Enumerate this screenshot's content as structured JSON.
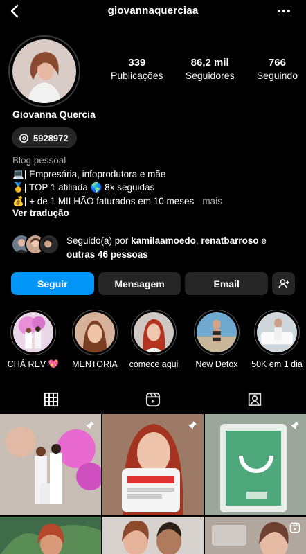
{
  "header": {
    "username": "giovannaquerciaa"
  },
  "profile": {
    "name": "Giovanna Quercia",
    "threads_count": "5928972",
    "stats": [
      {
        "num": "339",
        "label": "Publicações"
      },
      {
        "num": "86,2 mil",
        "label": "Seguidores"
      },
      {
        "num": "766",
        "label": "Seguindo"
      }
    ],
    "bio": {
      "category": "Blog pessoal",
      "line1": "💻| Empresária, infoprodutora e mãe",
      "line2": "🥇| TOP 1 afiliada 🌎 8x seguidas",
      "line3": "💰| + de 1 MILHÃO faturados em 10 meses",
      "more": "mais"
    },
    "translate": "Ver tradução",
    "followed_by": {
      "prefix": "Seguido(a) por ",
      "user1": "kamilaamoedo",
      "sep": ", ",
      "user2": "renatbarroso",
      "mid": " e ",
      "others": "outras 46 pessoas"
    }
  },
  "actions": {
    "follow": "Seguir",
    "message": "Mensagem",
    "email": "Email"
  },
  "highlights": [
    {
      "label": "CHÁ REV 💖"
    },
    {
      "label": "MENTORIA"
    },
    {
      "label": "comece aqui"
    },
    {
      "label": "New Detox"
    },
    {
      "label": "50K em 1 dia"
    }
  ],
  "colors": {
    "primary": "#0095f6",
    "button": "#262626",
    "background": "#000000"
  }
}
